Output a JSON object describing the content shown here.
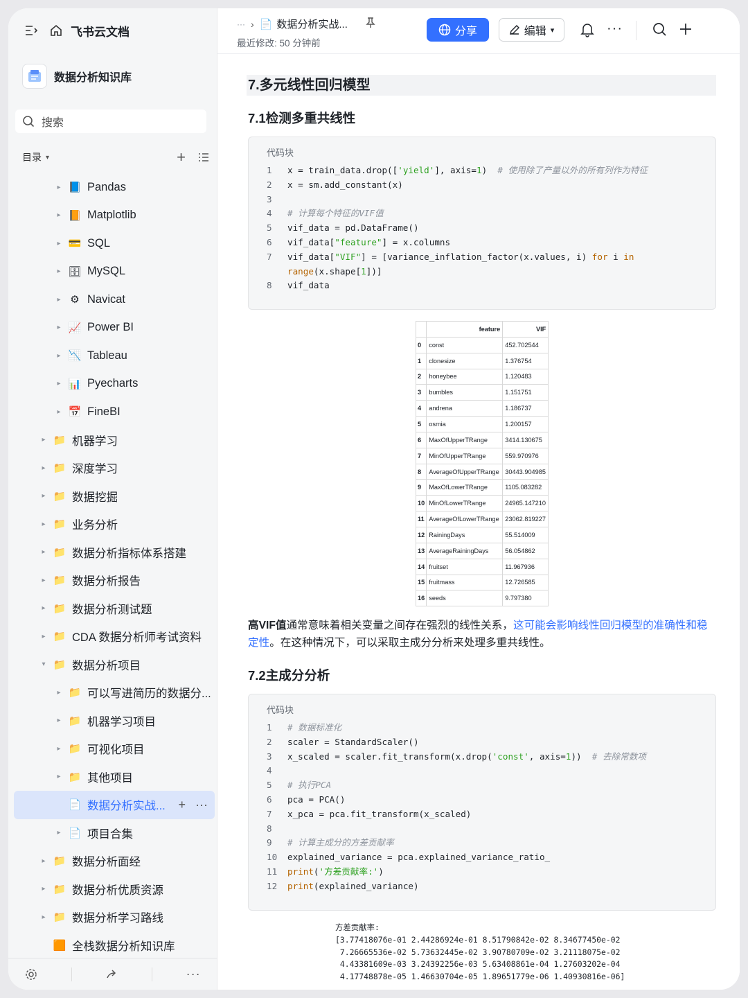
{
  "app": {
    "title": "飞书云文档"
  },
  "sidebar": {
    "kb_name": "数据分析知识库",
    "search_placeholder": "搜索",
    "toc_label": "目录",
    "items": [
      {
        "label": "Pandas",
        "icon": "📘",
        "level": 2,
        "expand": "▸"
      },
      {
        "label": "Matplotlib",
        "icon": "📙",
        "level": 2,
        "expand": "▸"
      },
      {
        "label": "SQL",
        "icon": "💳",
        "level": 2,
        "expand": "▸"
      },
      {
        "label": "MySQL",
        "icon": "🗄",
        "level": 2,
        "expand": "▸"
      },
      {
        "label": "Navicat",
        "icon": "⚙",
        "level": 2,
        "expand": "▸"
      },
      {
        "label": "Power BI",
        "icon": "📈",
        "level": 2,
        "expand": "▸"
      },
      {
        "label": "Tableau",
        "icon": "📉",
        "level": 2,
        "expand": "▸"
      },
      {
        "label": "Pyecharts",
        "icon": "📊",
        "level": 2,
        "expand": "▸"
      },
      {
        "label": "FineBI",
        "icon": "📅",
        "level": 2,
        "expand": "▸"
      },
      {
        "label": "机器学习",
        "icon": "📁",
        "level": 1,
        "expand": "▸"
      },
      {
        "label": "深度学习",
        "icon": "📁",
        "level": 1,
        "expand": "▸"
      },
      {
        "label": "数据挖掘",
        "icon": "📁",
        "level": 1,
        "expand": "▸"
      },
      {
        "label": "业务分析",
        "icon": "📁",
        "level": 1,
        "expand": "▸"
      },
      {
        "label": "数据分析指标体系搭建",
        "icon": "📁",
        "level": 1,
        "expand": "▸"
      },
      {
        "label": "数据分析报告",
        "icon": "📁",
        "level": 1,
        "expand": "▸"
      },
      {
        "label": "数据分析测试题",
        "icon": "📁",
        "level": 1,
        "expand": "▸"
      },
      {
        "label": "CDA 数据分析师考试资料",
        "icon": "📁",
        "level": 1,
        "expand": "▸"
      },
      {
        "label": "数据分析项目",
        "icon": "📁",
        "level": 1,
        "expand": "▾"
      },
      {
        "label": "可以写进简历的数据分...",
        "icon": "📁",
        "level": 2,
        "expand": "▸"
      },
      {
        "label": "机器学习项目",
        "icon": "📁",
        "level": 2,
        "expand": "▸"
      },
      {
        "label": "可视化项目",
        "icon": "📁",
        "level": 2,
        "expand": "▸"
      },
      {
        "label": "其他项目",
        "icon": "📁",
        "level": 2,
        "expand": "▸"
      },
      {
        "label": "数据分析实战...",
        "icon": "📄",
        "level": 2,
        "expand": "",
        "selected": true
      },
      {
        "label": "项目合集",
        "icon": "📄",
        "level": 2,
        "expand": "▸"
      },
      {
        "label": "数据分析面经",
        "icon": "📁",
        "level": 1,
        "expand": "▸"
      },
      {
        "label": "数据分析优质资源",
        "icon": "📁",
        "level": 1,
        "expand": "▸"
      },
      {
        "label": "数据分析学习路线",
        "icon": "📁",
        "level": 1,
        "expand": "▸"
      },
      {
        "label": "全栈数据分析知识库",
        "icon": "🟧",
        "level": 1,
        "expand": ""
      }
    ]
  },
  "header": {
    "ellipsis": "···",
    "doc_title": "数据分析实战...",
    "last_modified": "最近修改: 50 分钟前",
    "share_label": "分享",
    "edit_label": "编辑"
  },
  "doc": {
    "h2": "7.多元线性回归模型",
    "h3_1": "7.1检测多重共线性",
    "code_caption": "代码块",
    "code1": [
      {
        "n": "1",
        "html": "x = train_data.drop([<span class='str'>'yield'</span>], axis=<span class='num'>1</span>)  <span class='cm'># 使用除了产量以外的所有列作为特征</span>"
      },
      {
        "n": "2",
        "html": "x = sm.add_constant(x)"
      },
      {
        "n": "3",
        "html": ""
      },
      {
        "n": "4",
        "html": "<span class='cm'># 计算每个特征的VIF值</span>"
      },
      {
        "n": "5",
        "html": "vif_data = pd.DataFrame()"
      },
      {
        "n": "6",
        "html": "vif_data[<span class='str'>\"feature\"</span>] = x.columns"
      },
      {
        "n": "7",
        "html": "vif_data[<span class='str'>\"VIF\"</span>] = [variance_inflation_factor(x.values, i) <span class='kw'>for</span> i <span class='kw'>in</span>"
      },
      {
        "n": "",
        "html": "<span class='kw'>range</span>(x.shape[<span class='num'>1</span>])]"
      },
      {
        "n": "8",
        "html": "vif_data"
      }
    ],
    "vif_table": {
      "headers": [
        "",
        "feature",
        "VIF"
      ],
      "rows": [
        [
          "0",
          "const",
          "452.702544"
        ],
        [
          "1",
          "clonesize",
          "1.376754"
        ],
        [
          "2",
          "honeybee",
          "1.120483"
        ],
        [
          "3",
          "bumbles",
          "1.151751"
        ],
        [
          "4",
          "andrena",
          "1.186737"
        ],
        [
          "5",
          "osmia",
          "1.200157"
        ],
        [
          "6",
          "MaxOfUpperTRange",
          "3414.130675"
        ],
        [
          "7",
          "MinOfUpperTRange",
          "559.970976"
        ],
        [
          "8",
          "AverageOfUpperTRange",
          "30443.904985"
        ],
        [
          "9",
          "MaxOfLowerTRange",
          "1105.083282"
        ],
        [
          "10",
          "MinOfLowerTRange",
          "24965.147210"
        ],
        [
          "11",
          "AverageOfLowerTRange",
          "23062.819227"
        ],
        [
          "12",
          "RainingDays",
          "55.514009"
        ],
        [
          "13",
          "AverageRainingDays",
          "56.054862"
        ],
        [
          "14",
          "fruitset",
          "11.967936"
        ],
        [
          "15",
          "fruitmass",
          "12.726585"
        ],
        [
          "16",
          "seeds",
          "9.797380"
        ]
      ]
    },
    "para_bold": "高VIF值",
    "para_text1": "通常意味着相关变量之间存在强烈的线性关系，",
    "para_link": "这可能会影响线性回归模型的准确性和稳定性",
    "para_text2": "。在这种情况下，可以采取主成分分析来处理多重共线性。",
    "h3_2": "7.2主成分分析",
    "code2": [
      {
        "n": "1",
        "html": "<span class='cm'># 数据标准化</span>"
      },
      {
        "n": "2",
        "html": "scaler = StandardScaler()"
      },
      {
        "n": "3",
        "html": "x_scaled = scaler.fit_transform(x.drop(<span class='str'>'const'</span>, axis=<span class='num'>1</span>))  <span class='cm'># 去除常数项</span>"
      },
      {
        "n": "4",
        "html": ""
      },
      {
        "n": "5",
        "html": "<span class='cm'># 执行PCA</span>"
      },
      {
        "n": "6",
        "html": "pca = PCA()"
      },
      {
        "n": "7",
        "html": "x_pca = pca.fit_transform(x_scaled)"
      },
      {
        "n": "8",
        "html": ""
      },
      {
        "n": "9",
        "html": "<span class='cm'># 计算主成分的方差贡献率</span>"
      },
      {
        "n": "10",
        "html": "explained_variance = pca.explained_variance_ratio_"
      },
      {
        "n": "11",
        "html": "<span class='kw'>print</span>(<span class='str'>'方差贡献率:'</span>)"
      },
      {
        "n": "12",
        "html": "<span class='kw'>print</span>(explained_variance)"
      }
    ],
    "output": "方差贡献率:\n[3.77418076e-01 2.44286924e-01 8.51790842e-02 8.34677450e-02\n 7.26665536e-02 5.73632445e-02 3.90780709e-02 3.21118075e-02\n 4.43381609e-03 3.24392256e-03 5.63408861e-04 1.27603202e-04\n 4.17748878e-05 1.46630704e-05 1.89651779e-06 1.40930816e-06]"
  }
}
